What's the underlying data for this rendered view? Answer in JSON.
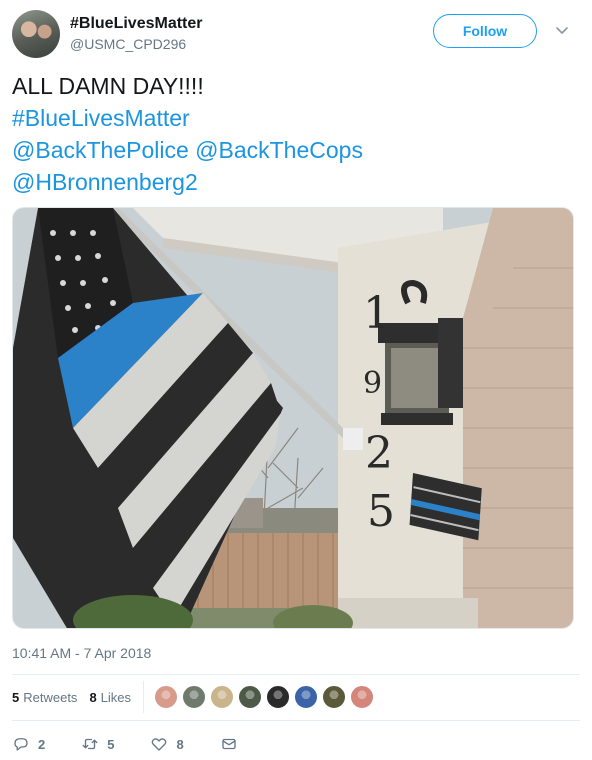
{
  "user": {
    "display_name": "#BlueLivesMatter",
    "handle": "@USMC_CPD296",
    "avatar_icon": "profile-photo"
  },
  "follow_label": "Follow",
  "caret_icon": "chevron-down-icon",
  "tweet": {
    "lines": [
      {
        "text": "ALL DAMN DAY!!!!",
        "is_link": false
      },
      {
        "text": "#BlueLivesMatter",
        "is_link": true
      },
      {
        "text": "@BackThePolice @BackTheCops",
        "is_link": true
      },
      {
        "text": "@HBronnenberg2",
        "is_link": true
      }
    ]
  },
  "media": {
    "house_number": "1925",
    "description_icon": "photo"
  },
  "timestamp": "10:41 AM - 7 Apr 2018",
  "stats": {
    "retweets_count": "5",
    "retweets_label": "Retweets",
    "likes_count": "8",
    "likes_label": "Likes"
  },
  "likers": [
    {
      "color": "#d89a8a"
    },
    {
      "color": "#6f7a6c"
    },
    {
      "color": "#c9b48c"
    },
    {
      "color": "#4e5a48"
    },
    {
      "color": "#2a2a2a"
    },
    {
      "color": "#3b63a8"
    },
    {
      "color": "#5a5a3a"
    },
    {
      "color": "#d4867a"
    }
  ],
  "actions": {
    "reply_count": "2",
    "retweet_count": "5",
    "like_count": "8"
  },
  "colors": {
    "accent": "#1da1f2",
    "link": "#1b95e0",
    "muted": "#657786"
  }
}
